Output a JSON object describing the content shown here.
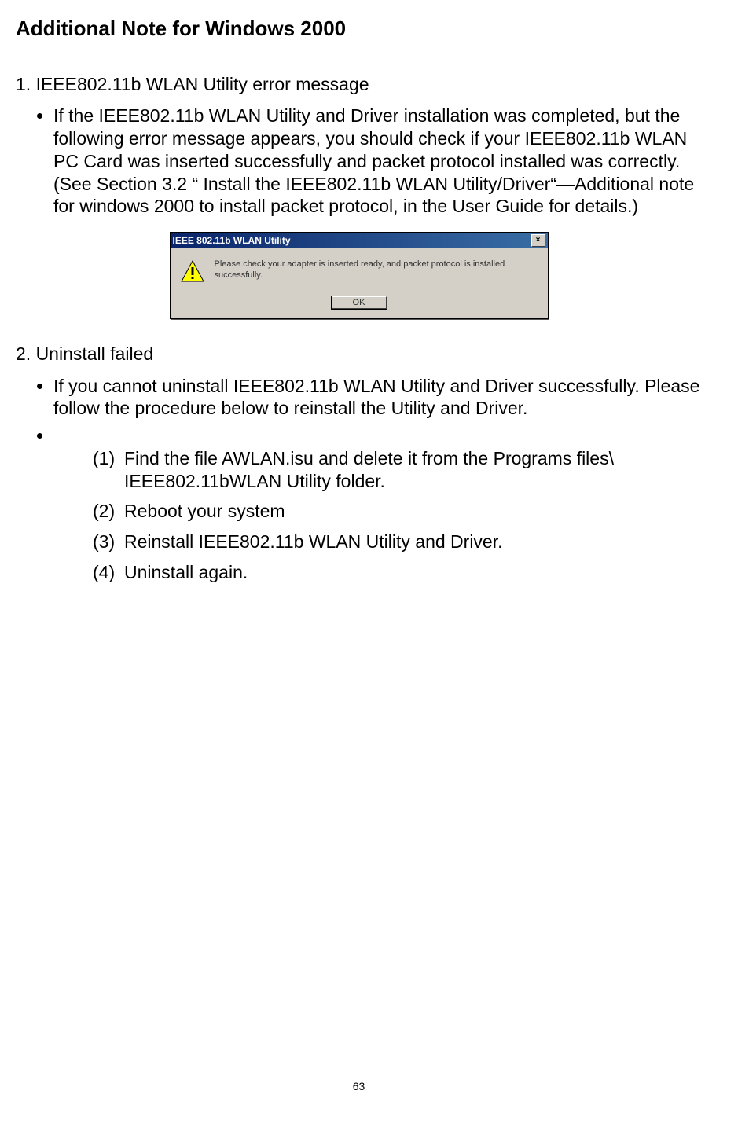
{
  "title": "Additional Note for Windows 2000",
  "section1": {
    "heading": "1. IEEE802.11b WLAN Utility error message",
    "bullet": "If the IEEE802.11b WLAN Utility and Driver installation was completed, but the following error message appears, you should check if your IEEE802.11b WLAN PC Card was inserted successfully and packet protocol installed was correctly. (See Section 3.2 “ Install the IEEE802.11b WLAN Utility/Driver“—Additional note for windows 2000 to install packet protocol, in the User Guide for details.)"
  },
  "dialog": {
    "title": "IEEE 802.11b WLAN Utility",
    "message": "Please check your adapter is inserted ready, and packet protocol is installed successfully.",
    "ok": "OK"
  },
  "section2": {
    "heading": "2. Uninstall failed",
    "bullet": "If you cannot uninstall IEEE802.11b WLAN Utility and Driver successfully. Please follow the procedure below to reinstall the Utility and Driver.",
    "steps": [
      {
        "n": "(1)",
        "t": "Find the file AWLAN.isu and delete it from the Programs files\\ IEEE802.11bWLAN Utility folder."
      },
      {
        "n": "(2)",
        "t": "Reboot your system"
      },
      {
        "n": "(3)",
        "t": "Reinstall IEEE802.11b WLAN Utility and Driver."
      },
      {
        "n": "(4)",
        "t": "Uninstall again."
      }
    ]
  },
  "page_number": "63"
}
